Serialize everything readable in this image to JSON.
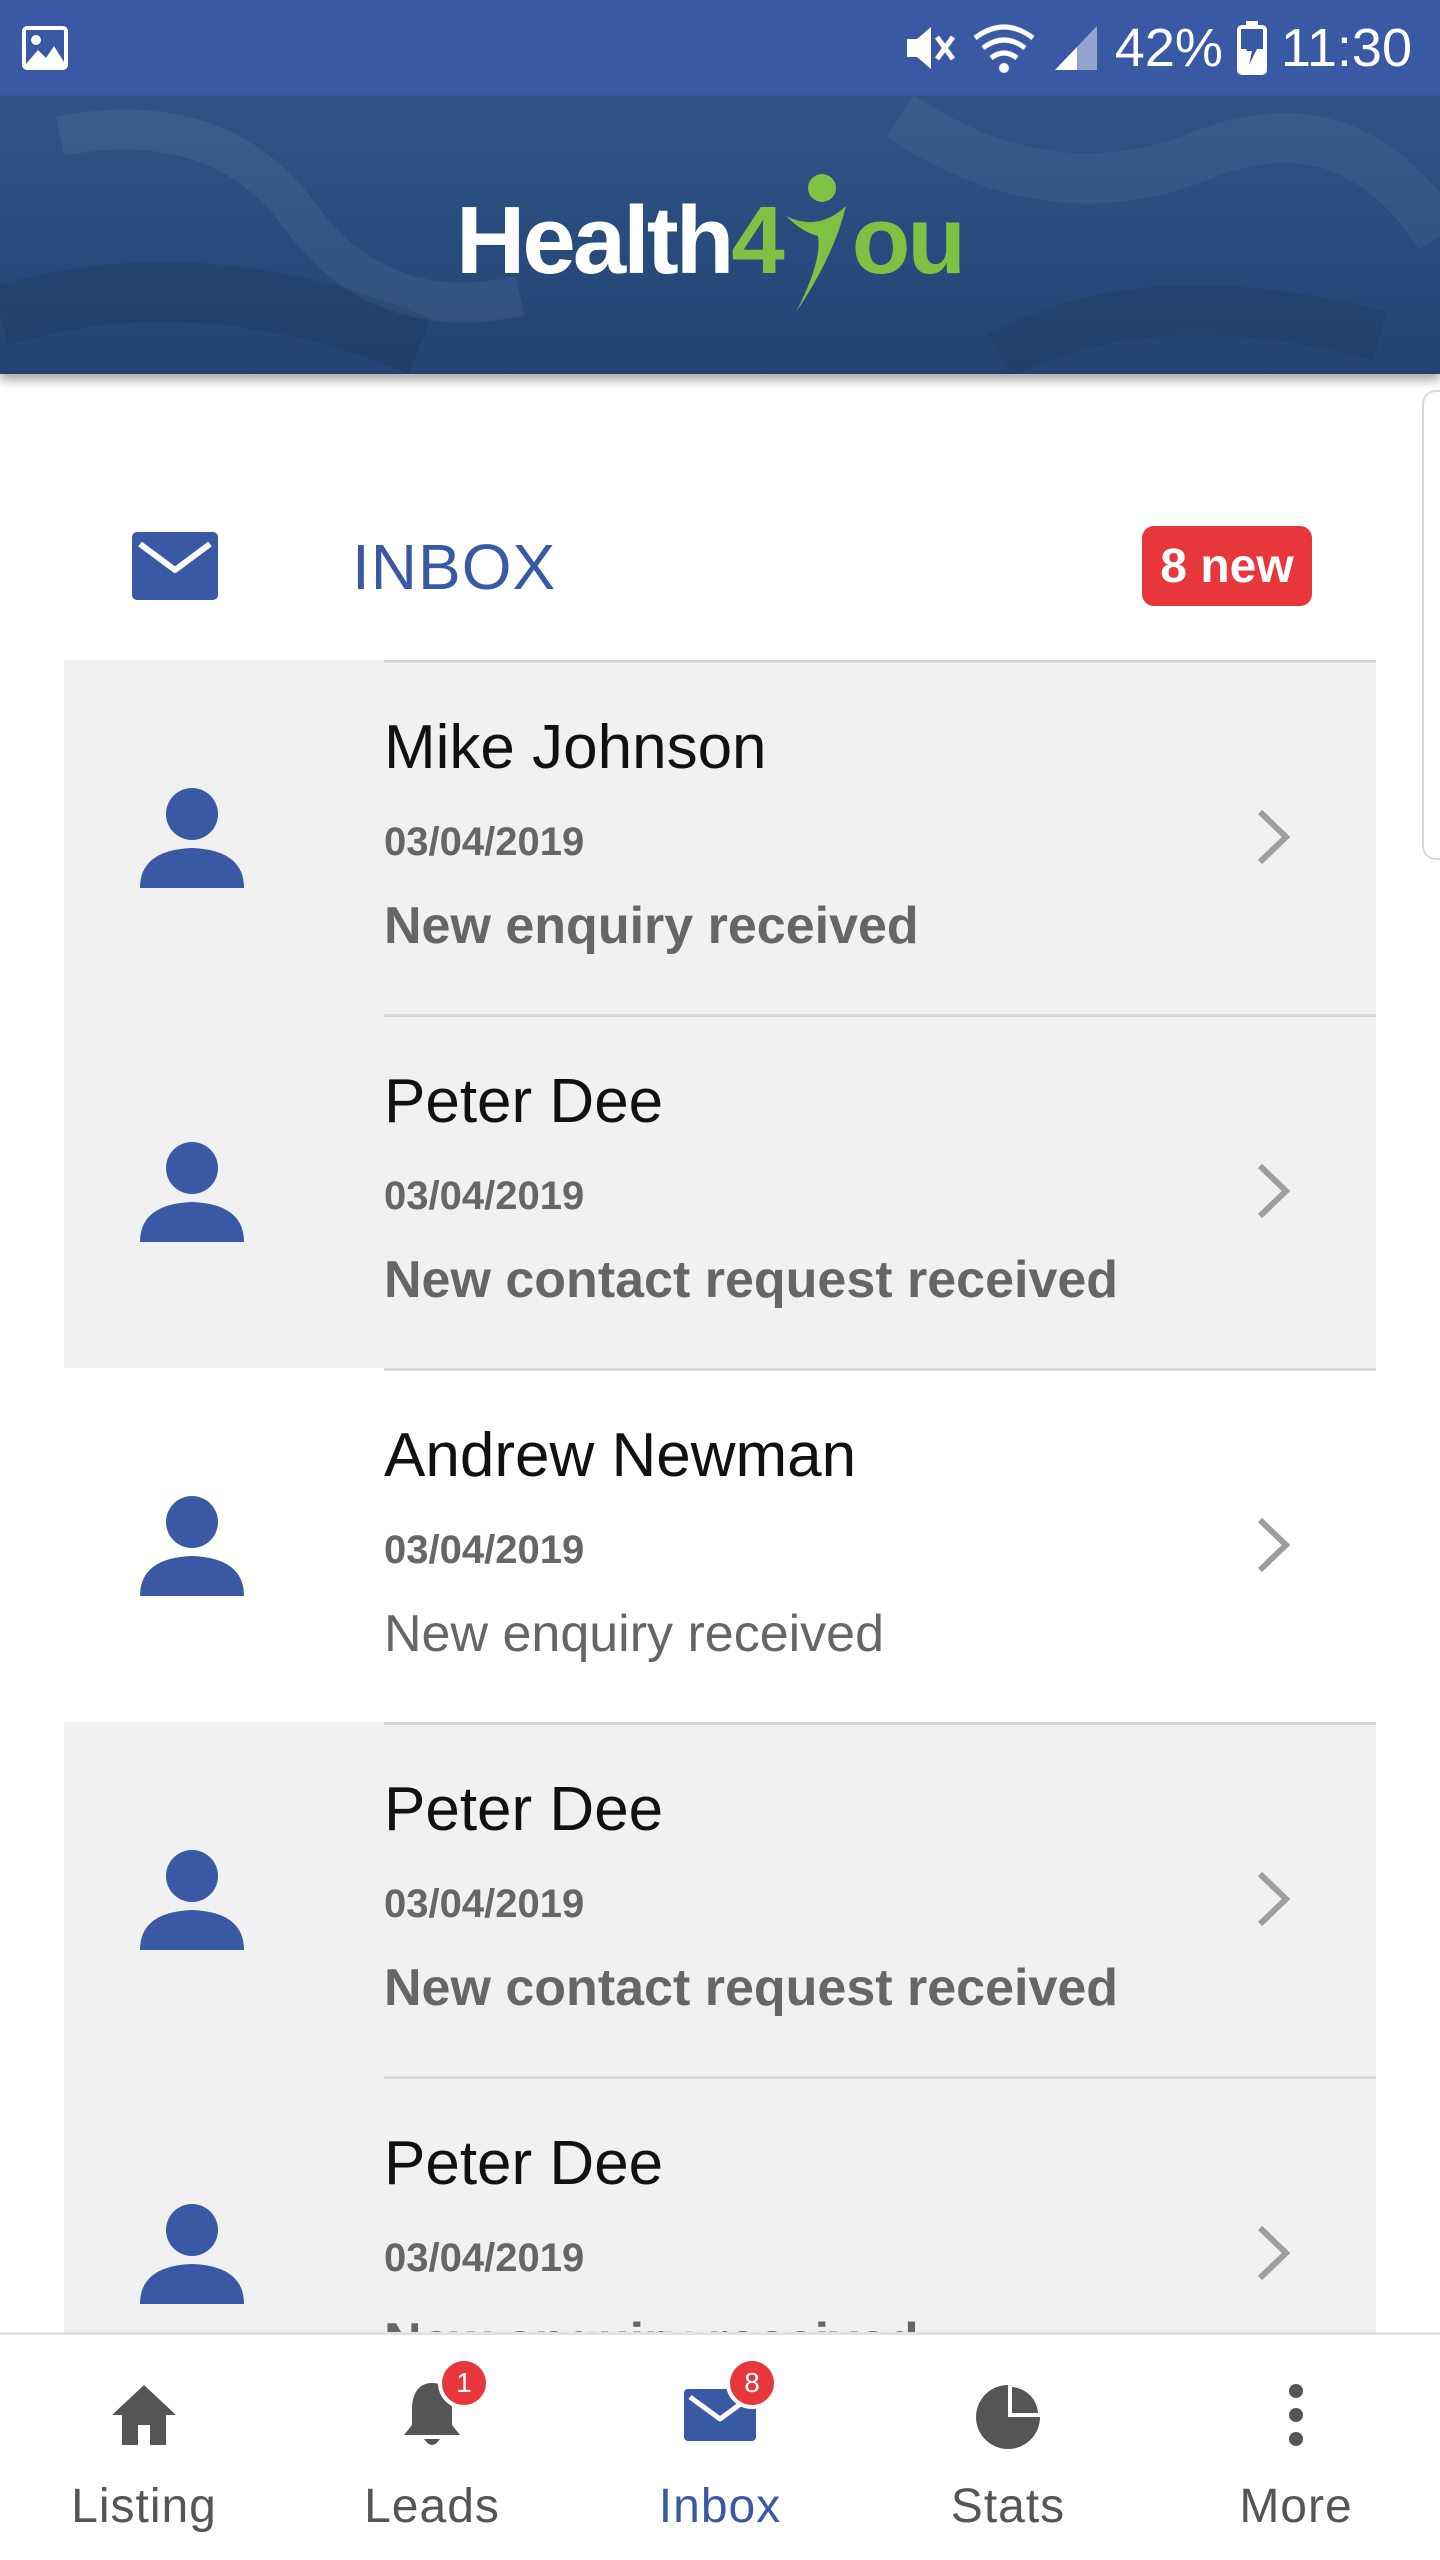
{
  "status_bar": {
    "battery": "42%",
    "time": "11:30"
  },
  "header": {
    "logo_left": "Health",
    "logo_four": "4",
    "logo_right": "ou"
  },
  "inbox": {
    "title": "INBOX",
    "new_badge": "8 new"
  },
  "messages": [
    {
      "name": "Mike Johnson",
      "date": "03/04/2019",
      "text": "New enquiry received",
      "unread": true
    },
    {
      "name": "Peter Dee",
      "date": "03/04/2019",
      "text": "New contact request received",
      "unread": true
    },
    {
      "name": "Andrew Newman",
      "date": "03/04/2019",
      "text": "New enquiry received",
      "unread": false
    },
    {
      "name": "Peter Dee",
      "date": "03/04/2019",
      "text": "New contact request received",
      "unread": true
    },
    {
      "name": "Peter Dee",
      "date": "03/04/2019",
      "text": "New enquiry received",
      "unread": true
    }
  ],
  "bottom_nav": [
    {
      "label": "Listing",
      "icon": "home-icon"
    },
    {
      "label": "Leads",
      "icon": "bell-icon",
      "badge": "1"
    },
    {
      "label": "Inbox",
      "icon": "mail-icon",
      "badge": "8",
      "active": true
    },
    {
      "label": "Stats",
      "icon": "pie-chart-icon"
    },
    {
      "label": "More",
      "icon": "more-vertical-icon"
    }
  ],
  "colors": {
    "primary": "#3a59a4",
    "badge": "#e8373a",
    "logo_green": "#7dc242",
    "unread_bg": "#f1f1f1"
  }
}
